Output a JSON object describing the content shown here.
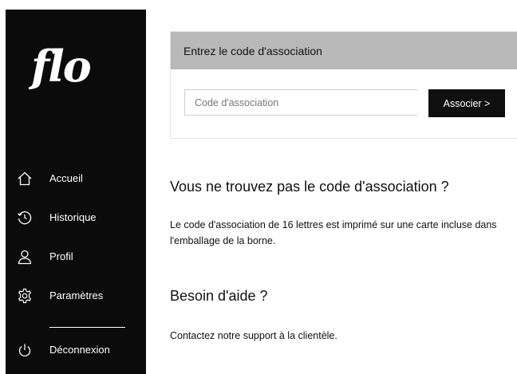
{
  "sidebar": {
    "logo": "flo",
    "items": [
      {
        "label": "Accueil",
        "icon": "home-icon"
      },
      {
        "label": "Historique",
        "icon": "history-icon"
      },
      {
        "label": "Profil",
        "icon": "user-icon"
      },
      {
        "label": "Paramètres",
        "icon": "gear-icon"
      }
    ],
    "logout": {
      "label": "Déconnexion",
      "icon": "power-icon"
    }
  },
  "association": {
    "header": "Entrez le code d'association",
    "input_placeholder": "Code d'association",
    "input_value": "",
    "button_label": "Associer >"
  },
  "help_code": {
    "title": "Vous ne trouvez pas le code d'association ?",
    "text": "Le code d'association de 16 lettres est imprimé sur une carte incluse dans l'emballage de la borne."
  },
  "help_support": {
    "title": "Besoin d'aide ?",
    "text": "Contactez notre support à la clientèle."
  },
  "colors": {
    "sidebar_bg": "#0b0b0b",
    "header_bg": "#b9b9b9",
    "button_bg": "#0f0f0f"
  }
}
